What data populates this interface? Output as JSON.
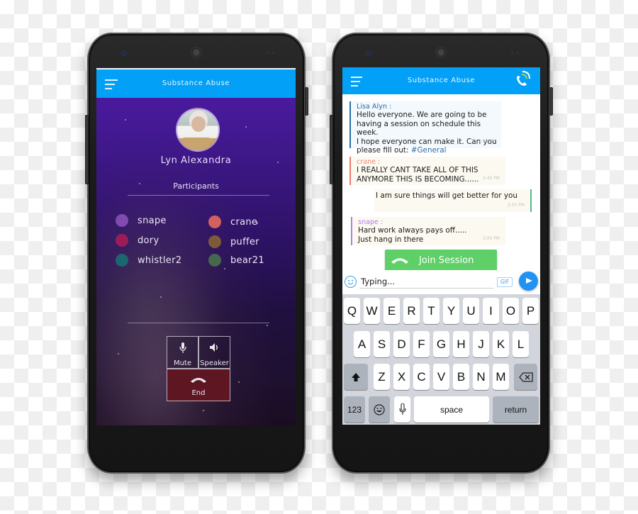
{
  "left_phone": {
    "appbar": {
      "title": "Substance Abuse",
      "menu_icon": "hamburger-icon"
    },
    "profile": {
      "name": "Lyn Alexandra",
      "avatar": "profile-photo"
    },
    "participants_label": "Participants",
    "participants": [
      {
        "name": "snape",
        "color": "#7e4bb0"
      },
      {
        "name": "crane",
        "color": "#d26060"
      },
      {
        "name": "dory",
        "color": "#9c1c5a"
      },
      {
        "name": "puffer",
        "color": "#7c5a3a"
      },
      {
        "name": "whistler2",
        "color": "#1c6670"
      },
      {
        "name": "bear21",
        "color": "#45684e"
      }
    ],
    "controls": {
      "mute_label": "Mute",
      "speaker_label": "Speaker",
      "end_label": "End"
    }
  },
  "right_phone": {
    "appbar": {
      "title": "Substance Abuse",
      "menu_icon": "hamburger-icon",
      "call_icon": "phone-call-icon"
    },
    "messages": [
      {
        "sender": "Lisa Alyn :",
        "lines": [
          "Hello everyone. We are going to be",
          "having a session on schedule this week.",
          "I hope everyone can make it. Can you",
          "please fill out: "
        ],
        "hashtag": "#General",
        "time": "2:45 PM",
        "accent": "#2b6fa8"
      },
      {
        "sender": "crane :",
        "lines": [
          "I REALLY CANT TAKE ALL OF THIS",
          "ANYMORE THIS IS BECOMING......"
        ],
        "time": "2:45 PM",
        "accent": "#f07a6a"
      },
      {
        "sender": "",
        "lines": [
          "I am sure things will get better for you"
        ],
        "time": "2:55 PM",
        "accent": "#55b98a"
      },
      {
        "sender": "snape :",
        "lines": [
          "Hard work always pays off.....",
          "Just hang in there"
        ],
        "time": "3:00 PM",
        "accent": "#b07ee6"
      }
    ],
    "join_button": {
      "label": "Join Session",
      "color": "#5fd068"
    },
    "composer": {
      "value": "Typing...",
      "gif_label": "GIF",
      "send_icon": "send-icon",
      "emoji_icon": "emoji-icon"
    },
    "keyboard": {
      "row1": [
        "Q",
        "W",
        "E",
        "R",
        "T",
        "Y",
        "U",
        "I",
        "O",
        "P"
      ],
      "row2": [
        "A",
        "S",
        "D",
        "F",
        "G",
        "H",
        "J",
        "K",
        "L"
      ],
      "row3": [
        "Z",
        "X",
        "C",
        "V",
        "B",
        "N",
        "M"
      ],
      "numbers_label": "123",
      "space_label": "space",
      "return_label": "return"
    }
  },
  "colors": {
    "appbar": "#03a0f7",
    "end_button": "#5e1722"
  }
}
